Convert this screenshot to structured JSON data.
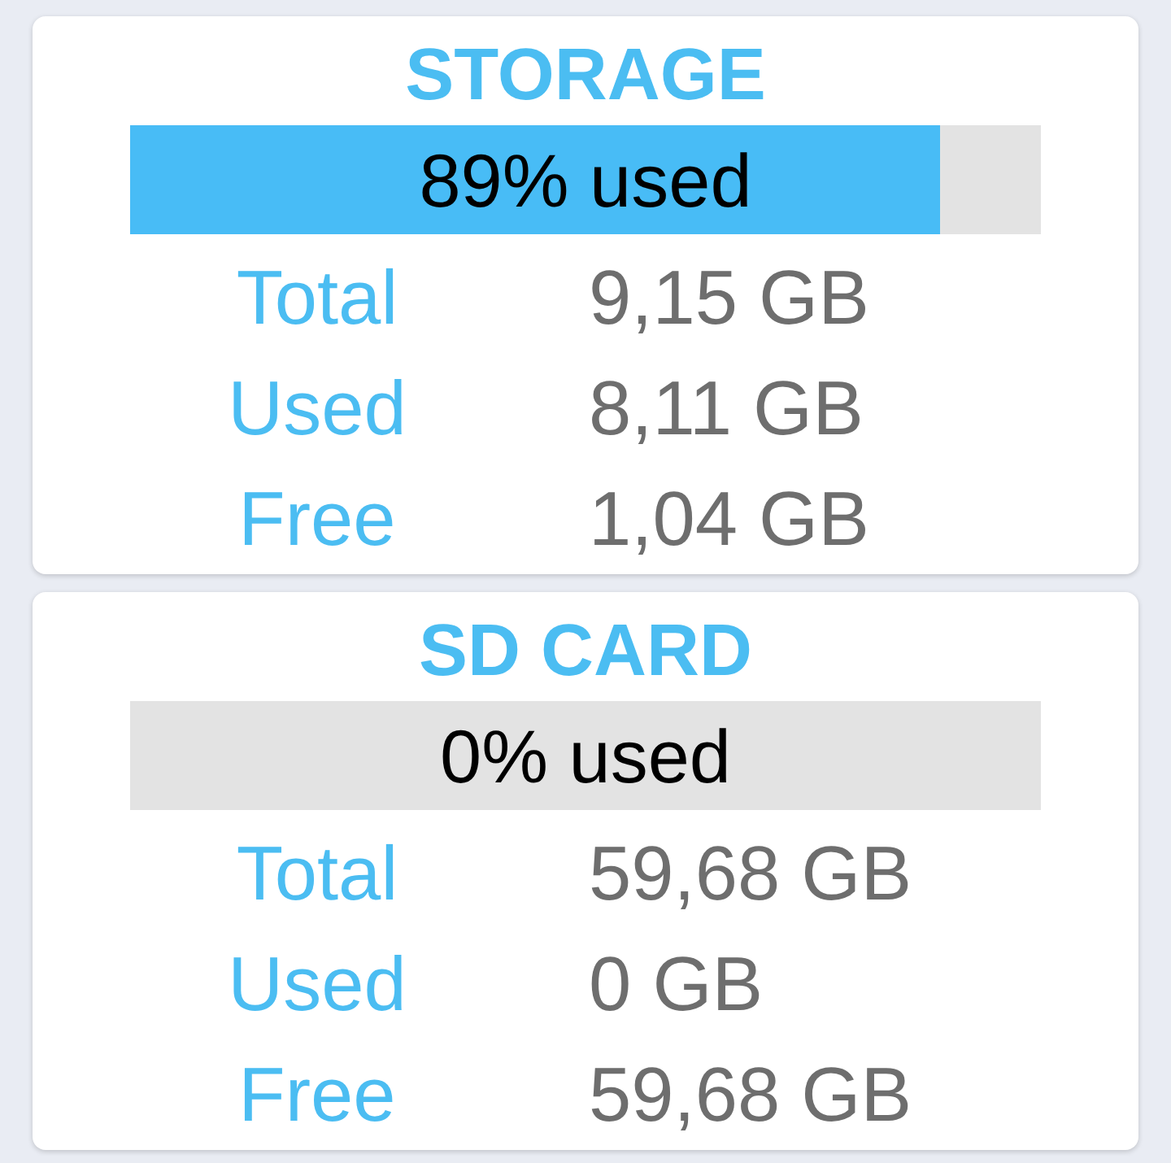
{
  "cards": [
    {
      "title": "STORAGE",
      "usage": {
        "level": 0.89,
        "label": "89% used"
      },
      "rows": [
        {
          "label": "Total",
          "value": "9,15 GB"
        },
        {
          "label": "Used",
          "value": "8,11 GB"
        },
        {
          "label": "Free",
          "value": "1,04 GB"
        }
      ]
    },
    {
      "title": "SD CARD",
      "usage": {
        "label": "0% used"
      },
      "rows": [
        {
          "label": "Total",
          "value": "59,68 GB"
        },
        {
          "label": "Used",
          "value": "0 GB"
        },
        {
          "label": "Free",
          "value": "59,68 GB"
        }
      ]
    }
  ]
}
